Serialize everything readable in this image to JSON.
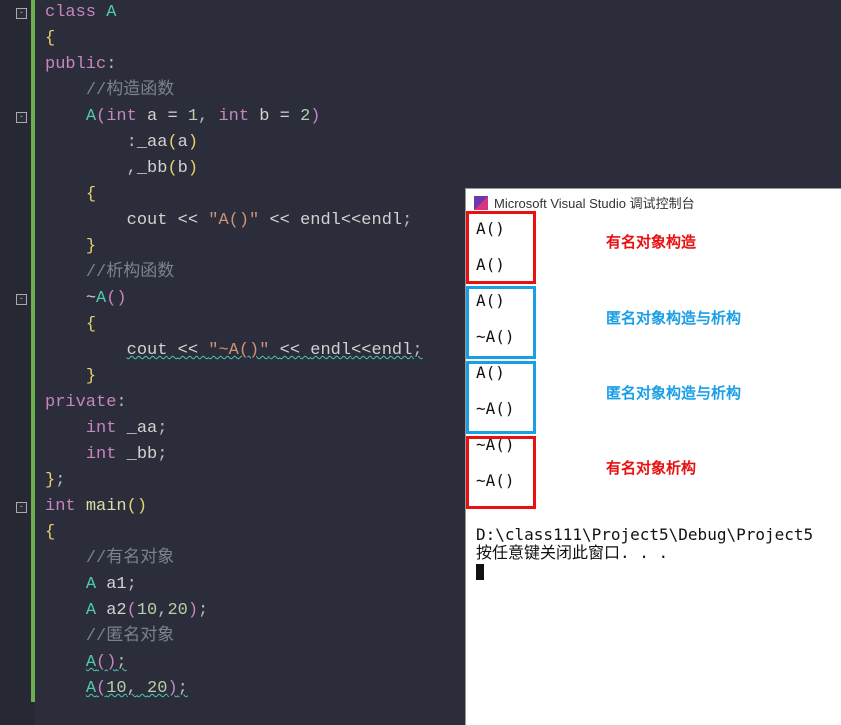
{
  "code": {
    "l1_class": "class",
    "l1_name": "A",
    "l2_brace": "{",
    "l3_public": "public",
    "l3_colon": ":",
    "l4_comment": "//构造函数",
    "l5_ctor": "A",
    "l5_int1": "int",
    "l5_a": "a",
    "l5_eq1": "=",
    "l5_1": "1",
    "l5_comma": ",",
    "l5_int2": "int",
    "l5_b": "b",
    "l5_eq2": "=",
    "l5_2": "2",
    "l6_colon": ":",
    "l6_aa": "_aa",
    "l6_a": "a",
    "l7_comma": ",",
    "l7_bb": "_bb",
    "l7_b": "b",
    "l8_brace": "{",
    "l9_cout": "cout",
    "l9_str": "\"A()\"",
    "l9_endl1": "endl",
    "l9_endl2": "endl",
    "l10_brace": "}",
    "l11_comment": "//析构函数",
    "l12_tilde": "~",
    "l12_dtor": "A",
    "l13_brace": "{",
    "l14_cout": "cout",
    "l14_str": "\"~A()\"",
    "l14_endl1": "endl",
    "l14_endl2": "endl",
    "l15_brace": "}",
    "l16_private": "private",
    "l16_colon": ":",
    "l17_int": "int",
    "l17_aa": "_aa",
    "l18_int": "int",
    "l18_bb": "_bb",
    "l19_brace": "}",
    "l20_int": "int",
    "l20_main": "main",
    "l21_brace": "{",
    "l22_comment": "//有名对象",
    "l23_A": "A",
    "l23_a1": "a1",
    "l24_A": "A",
    "l24_a2": "a2",
    "l24_10": "10",
    "l24_20": "20",
    "l25_comment": "//匿名对象",
    "l26_A": "A",
    "l27_A": "A",
    "l27_10": "10",
    "l27_20": "20"
  },
  "console": {
    "title": "Microsoft Visual Studio 调试控制台",
    "out1": "A()",
    "out2": "A()",
    "out3": "A()",
    "out4": "~A()",
    "out5": "A()",
    "out6": "~A()",
    "out7": "~A()",
    "out8": "~A()",
    "path": "D:\\class111\\Project5\\Debug\\Project5",
    "prompt": "按任意键关闭此窗口. . ."
  },
  "annotations": {
    "named_ctor": "有名对象构造",
    "anon1": "匿名对象构造与析构",
    "anon2": "匿名对象构造与析构",
    "named_dtor": "有名对象析构"
  }
}
